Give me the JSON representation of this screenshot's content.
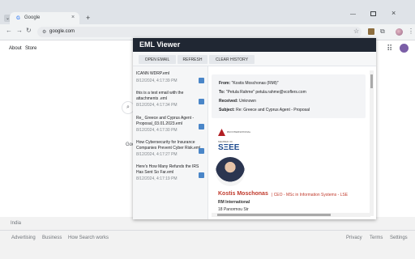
{
  "browser": {
    "tab": {
      "title": "Google",
      "favicon": "G"
    },
    "address": "google.com",
    "icons": [
      "tab-dropdown-icon",
      "close-icon",
      "new-tab-icon",
      "back-icon",
      "forward-icon",
      "reload-icon",
      "site-info-icon",
      "star-icon",
      "extension-icon",
      "puzzle-icon",
      "menu-icon"
    ]
  },
  "google": {
    "about": "About",
    "store": "Store",
    "peek_text": "Goo",
    "country": "India",
    "footer_links": [
      "Advertising",
      "Business",
      "How Search works"
    ],
    "footer_right": [
      "Privacy",
      "Terms",
      "Settings"
    ]
  },
  "eml_viewer": {
    "title": "EML Viewer",
    "buttons": {
      "open": "OPEN EMAIL",
      "refresh": "REFRESH",
      "clear": "CLEAR HISTORY"
    },
    "history": [
      {
        "name": "ICANN WDRP.eml",
        "date": "8/12/2024, 4:17:39 PM"
      },
      {
        "name": "this is a test email with the attachments .eml",
        "date": "8/12/2024, 4:17:34 PM"
      },
      {
        "name": "Re_ Greece and Cyprus Agent - Proposal_03.01.2023.eml",
        "date": "8/12/2024, 4:17:30 PM"
      },
      {
        "name": "How Cybersecurity for Insurance Companies Prevent Cyber Risk.eml",
        "date": "8/12/2024, 4:17:27 PM"
      },
      {
        "name": "Here's How Many Refunds the IRS Has Sent So Far.eml",
        "date": "8/12/2024, 4:17:19 PM"
      }
    ],
    "header": {
      "from_label": "From:",
      "from_value": "\"Kostis Moschonas (RMI)\"",
      "to_label": "To:",
      "to_value": "\"Petula Rahme\" petula.rahme@vcoflers.com",
      "received_label": "Received:",
      "received_value": "Unknown",
      "subject_label": "Subject:",
      "subject_value": "Re: Greece and Cyprus Agent - Proposal"
    },
    "signature": {
      "logo_text": "RM INTERNATIONAL",
      "sxee_top": "MEMBER OF",
      "sxee": "SΞEE",
      "name": "Kostis Moschonas",
      "title": "| CEO - MSc in Information Systems - LSE",
      "company": "RM International",
      "address": "18 Panormou Str"
    }
  }
}
